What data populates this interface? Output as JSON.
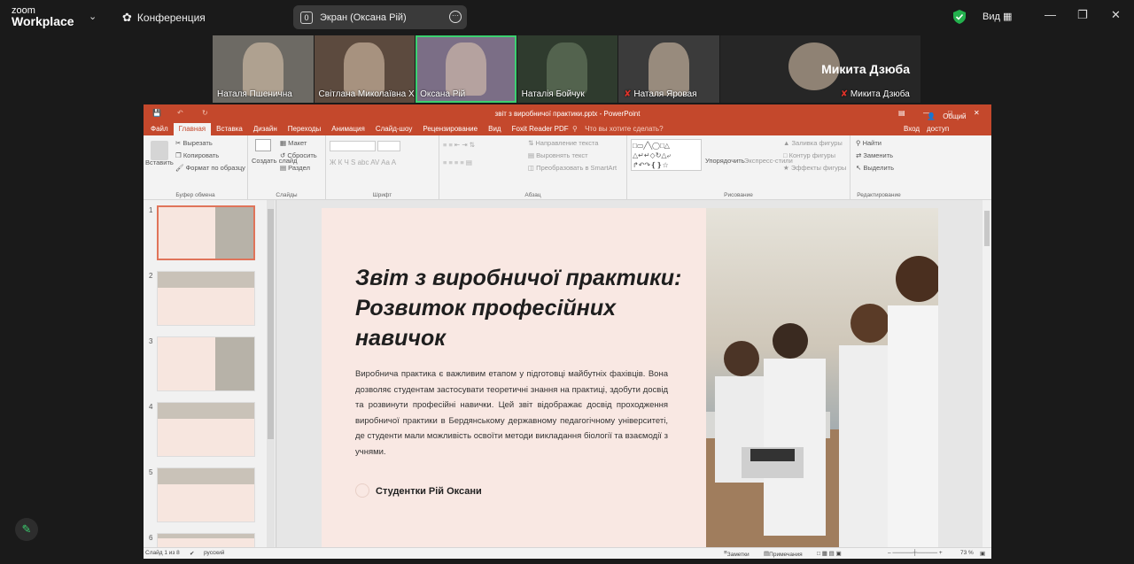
{
  "app": {
    "logo_top": "zoom",
    "logo_bottom": "Workplace",
    "meeting_label": "Конференция"
  },
  "share": {
    "count": "0",
    "label": "Экран (Оксана Рій)"
  },
  "topright": {
    "view_label": "Вид"
  },
  "participants": [
    {
      "name": "Наталя Пшенична",
      "muted": false,
      "active": false,
      "bg": "#6d6a64"
    },
    {
      "name": "Світлана Миколаївна Хат...",
      "muted": false,
      "active": false,
      "bg": "#5c4a3e"
    },
    {
      "name": "Оксана Рій",
      "muted": false,
      "active": true,
      "bg": "#7b6e86"
    },
    {
      "name": "Наталія Бойчук",
      "muted": false,
      "active": false,
      "bg": "#2f3b2e"
    },
    {
      "name": "Наталя Яровая",
      "muted": true,
      "active": false,
      "bg": "#3b3b3b"
    },
    {
      "name": "Микита Дзюба",
      "muted": true,
      "active": false,
      "bg": "#262626",
      "big_name": "Микита Дзюба"
    }
  ],
  "ppt": {
    "title": "звіт з виробничої практики.pptx - PowerPoint",
    "tabs": [
      "Файл",
      "Главная",
      "Вставка",
      "Дизайн",
      "Переходы",
      "Анимация",
      "Слайд-шоу",
      "Рецензирование",
      "Вид",
      "Foxit Reader PDF"
    ],
    "tell_me": "Что вы хотите сделать?",
    "login": "Вход",
    "share": "Общий доступ",
    "ribbon": {
      "paste": "Вставить",
      "cut": "Вырезать",
      "copy": "Копировать",
      "format": "Формат по образцу",
      "clipboard": "Буфер обмена",
      "new_slide": "Создать слайд",
      "layout": "Макет",
      "reset": "Сбросить",
      "section": "Раздел",
      "slides": "Слайды",
      "font": "Шрифт",
      "paragraph": "Абзац",
      "text_dir": "Направление текста",
      "align_text": "Выровнять текст",
      "smartart": "Преобразовать в SmartArt",
      "arrange": "Упорядочить",
      "quick_styles": "Экспресс-стили",
      "fill": "Заливка фигуры",
      "outline": "Контур фигуры",
      "effects": "Эффекты фигуры",
      "drawing": "Рисование",
      "find": "Найти",
      "replace": "Заменить",
      "select": "Выделить",
      "editing": "Редактирование"
    },
    "thumb_numbers": [
      "1",
      "2",
      "3",
      "4",
      "5",
      "6"
    ],
    "slide": {
      "title": "Звіт з виробничої практики: Розвиток професійних навичок",
      "body": "Виробнича практика є важливим етапом у підготовці майбутніх фахівців. Вона дозволяє студентам застосувати теоретичні знання на практиці, здобути досвід та розвинути професійні навички. Цей звіт відображає досвід проходження виробничої практики в Бердянському державному педагогічному університеті, де студенти мали можливість освоїти методи викладання біології та взаємодії з учнями.",
      "author": "Студентки Рій Оксани"
    },
    "status": {
      "slide": "Слайд 1 из 8",
      "lang": "русский",
      "notes": "Заметки",
      "comments": "Примечания",
      "zoom": "73 %"
    }
  }
}
